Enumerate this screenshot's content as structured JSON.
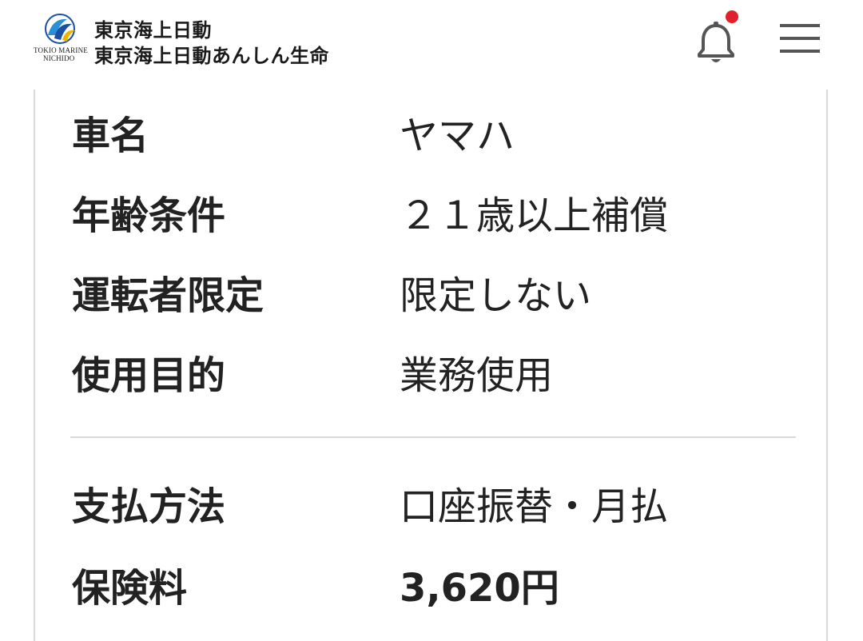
{
  "header": {
    "logo_text_line1": "TOKIO MARINE",
    "logo_text_line2": "NICHIDO",
    "brand_line1": "東京海上日動",
    "brand_line2": "東京海上日動あんしん生命",
    "notification_badge_color": "#e0202b",
    "icons": [
      "tokio-marine-logo",
      "bell-icon",
      "hamburger-menu-icon"
    ]
  },
  "details": {
    "rows": [
      {
        "label": "車名",
        "value": "ヤマハ"
      },
      {
        "label": "年齢条件",
        "value": "２１歳以上補償"
      },
      {
        "label": "運転者限定",
        "value": "限定しない"
      },
      {
        "label": "使用目的",
        "value": "業務使用"
      }
    ]
  },
  "payment": {
    "rows": [
      {
        "label": "支払方法",
        "value": "口座振替・月払"
      },
      {
        "label": "保険料",
        "value": "3,620円"
      }
    ]
  }
}
